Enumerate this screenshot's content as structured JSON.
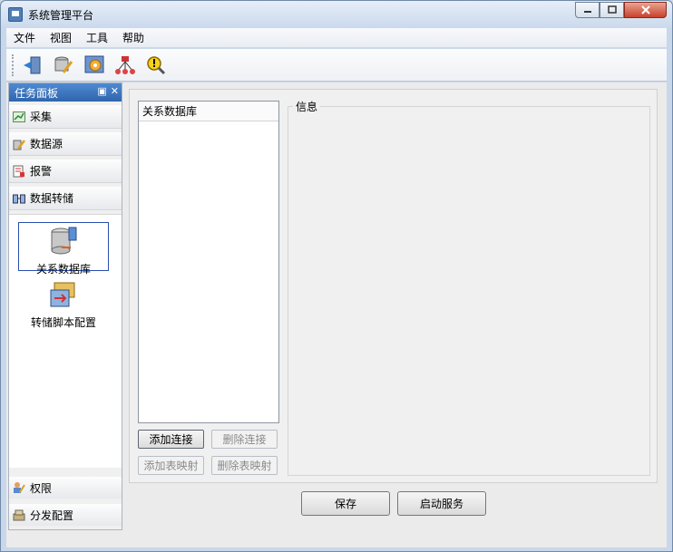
{
  "window": {
    "title": "系统管理平台"
  },
  "menu": [
    "文件",
    "视图",
    "工具",
    "帮助"
  ],
  "toolbar": {
    "icons": [
      "import-icon",
      "datasource-edit-icon",
      "config-gear-icon",
      "network-topology-icon",
      "alarm-search-icon"
    ]
  },
  "taskpanel": {
    "title": "任务面板",
    "sections": [
      {
        "label": "采集",
        "icon": "chart-icon"
      },
      {
        "label": "数据源",
        "icon": "datasource-icon"
      },
      {
        "label": "报警",
        "icon": "alarm-icon"
      },
      {
        "label": "数据转储",
        "icon": "data-transfer-icon"
      }
    ],
    "items": [
      {
        "label": "关系数据库",
        "icon": "database-icon"
      },
      {
        "label": "转储脚本配置",
        "icon": "script-config-icon"
      }
    ],
    "bottom": [
      {
        "label": "权限",
        "icon": "users-icon"
      },
      {
        "label": "分发配置",
        "icon": "distribution-icon"
      }
    ]
  },
  "main": {
    "list_header": "关系数据库",
    "info_title": "信息",
    "buttons": {
      "add_connection": "添加连接",
      "delete_connection": "删除连接",
      "add_table_mapping": "添加表映射",
      "delete_table_mapping": "删除表映射"
    }
  },
  "footer": {
    "save": "保存",
    "start_service": "启动服务"
  }
}
